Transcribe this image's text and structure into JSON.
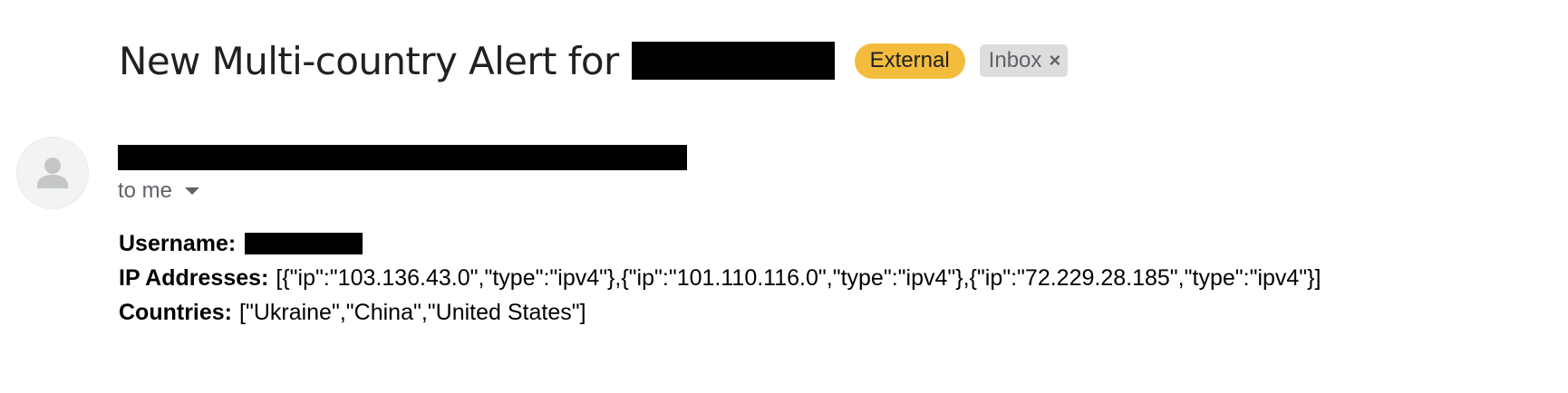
{
  "subject": {
    "title": "New Multi-country Alert for",
    "labels": {
      "external": "External",
      "inbox": "Inbox",
      "inbox_close": "×"
    }
  },
  "sender": {
    "recipient_text": "to me",
    "avatar_icon": "person-icon"
  },
  "message": {
    "username_label": "Username:",
    "ip_label": "IP Addresses:",
    "ip_value": "[{\"ip\":\"103.136.43.0\",\"type\":\"ipv4\"},{\"ip\":\"101.110.116.0\",\"type\":\"ipv4\"},{\"ip\":\"72.229.28.185\",\"type\":\"ipv4\"}]",
    "countries_label": "Countries:",
    "countries_value": "[\"Ukraine\",\"China\",\"United States\"]"
  },
  "colors": {
    "external_label_bg": "#f3bc3d",
    "inbox_label_bg": "#dddddd",
    "redaction": "#000000"
  }
}
